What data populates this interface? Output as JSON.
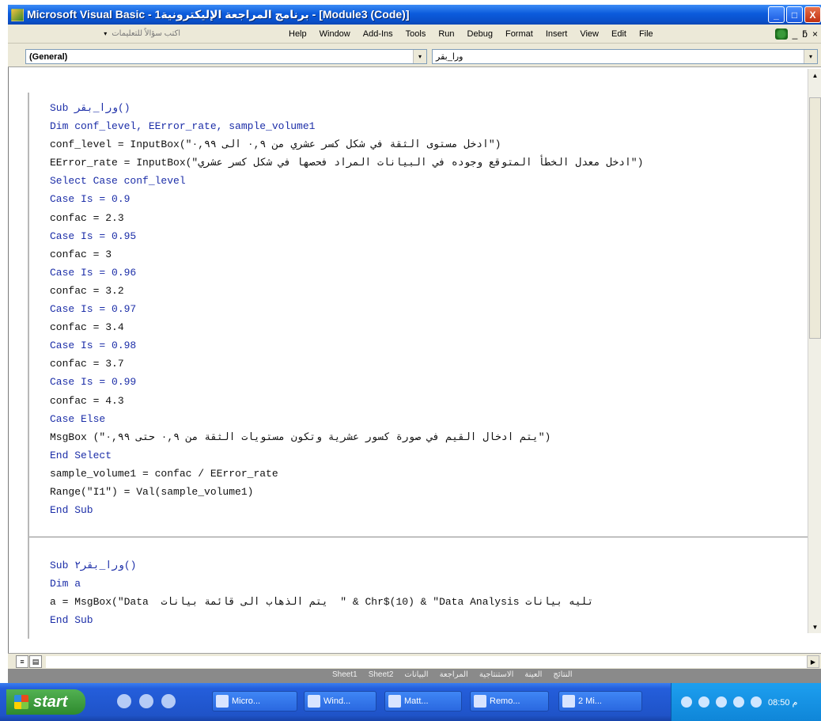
{
  "window": {
    "title": "Microsoft Visual Basic - برنامج المراجعة الإليكترونية1 - [Module3 (Code)]",
    "controls": {
      "minimize": "_",
      "restore": "□",
      "close": "X"
    }
  },
  "menubar": {
    "help_placeholder": "اكتب سؤالاً للتعليمات",
    "help_dropdown": "▾",
    "items": [
      "Help",
      "Window",
      "Add-Ins",
      "Tools",
      "Run",
      "Debug",
      "Format",
      "Insert",
      "View",
      "Edit",
      "File"
    ],
    "tail": [
      "_",
      "ƃ",
      "×"
    ]
  },
  "combos": {
    "object": "(General)",
    "procedure": "ورا_بقر",
    "arrow": "▾"
  },
  "code": {
    "proc1": [
      "Sub ورا_بقر()",
      "Dim conf_level, EError_rate, sample_volume1",
      "conf_level = InputBox(\"ادخل مستوى الثقة في شكل كسر عشري من ٠,٩ الى ٠,٩٩\")",
      "EError_rate = InputBox(\"ادخل معدل الخطأ المتوقع وجوده في البيانات المراد فحصها في شكل كسر عشري\")",
      "Select Case conf_level",
      "Case Is = 0.9",
      "confac = 2.3",
      "Case Is = 0.95",
      "confac = 3",
      "Case Is = 0.96",
      "confac = 3.2",
      "Case Is = 0.97",
      "confac = 3.4",
      "Case Is = 0.98",
      "confac = 3.7",
      "Case Is = 0.99",
      "confac = 4.3",
      "Case Else",
      "MsgBox (\"يتم ادخال القيم في صورة كسور عشرية وتكون مستويات الثقة من ٠,٩ حتى ٠,٩٩\")",
      "End Select",
      "sample_volume1 = confac / EError_rate",
      "Range(\"I1\") = Val(sample_volume1)",
      "End Sub"
    ],
    "proc2": [
      "Sub ورا_بقر٢()",
      "Dim a",
      "a = MsgBox(\"Data  يتم الذهاب الى قائمة بيانات  \" & Chr$(10) & \"Data Analysis تليه بيانات",
      "End Sub"
    ]
  },
  "scrollbars": {
    "up": "▲",
    "down": "▼",
    "right": "▶",
    "left": "◀"
  },
  "view_buttons": [
    "≡",
    "▤"
  ],
  "sheet_tabs": [
    "Sheet1",
    "Sheet2",
    "البيانات",
    "المراجعة",
    "الاستنتاجية",
    "العينة",
    "النتائج"
  ],
  "taskbar": {
    "start_label": "start",
    "tasks": [
      "Micro...",
      "Wind...",
      "Matt...",
      "Remo...",
      "2 Mi..."
    ],
    "clock": "08:50 م"
  }
}
